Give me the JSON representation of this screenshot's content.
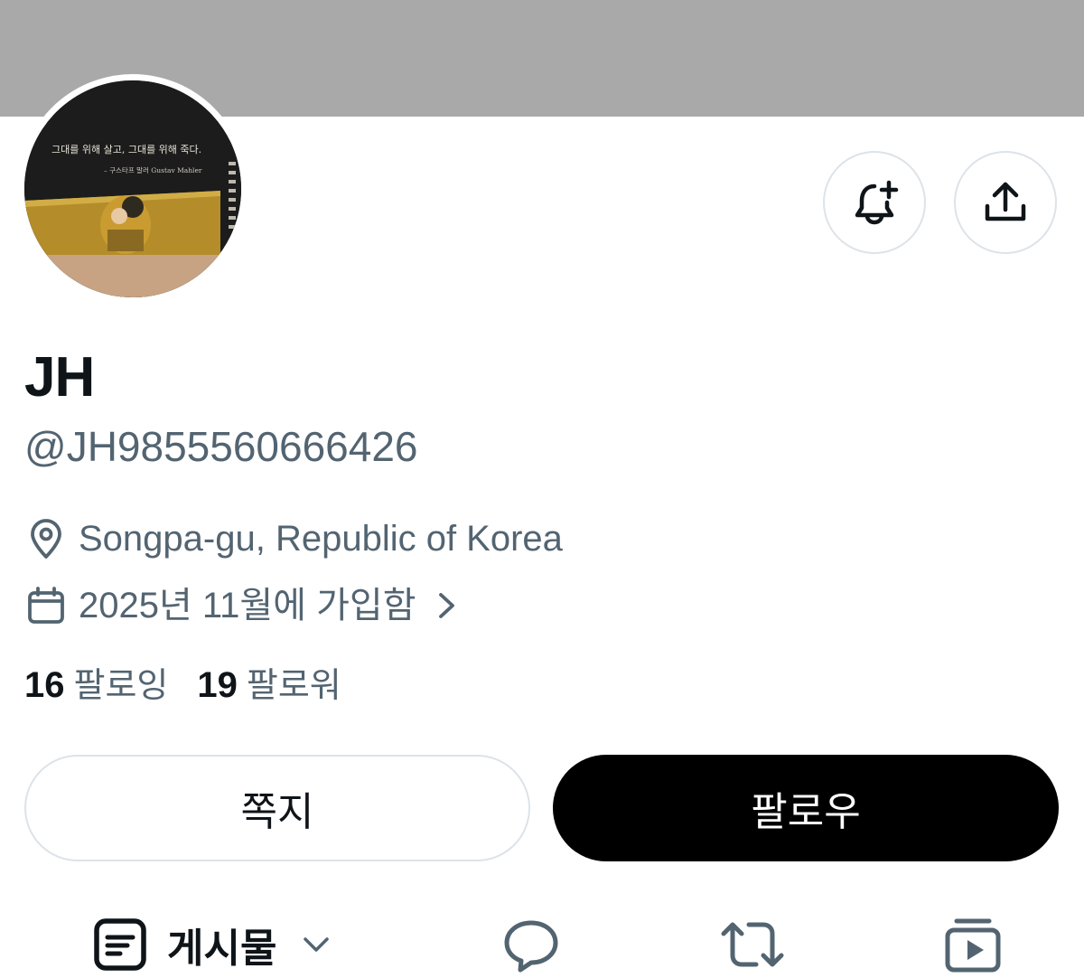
{
  "profile": {
    "display_name": "JH",
    "handle": "@JH9855560666426",
    "location": "Songpa-gu, Republic of Korea",
    "joined": "2025년 11월에 가입함",
    "following_count": "16",
    "following_label": "팔로잉",
    "followers_count": "19",
    "followers_label": "팔로워",
    "avatar_caption": "그대를 위해 살고, 그대를 위해 죽다.",
    "avatar_attribution": "– 구스타프 말러 Gustav Mahler"
  },
  "actions": {
    "message_label": "쪽지",
    "follow_label": "팔로우"
  },
  "tabs": {
    "posts_label": "게시물"
  },
  "icons": {
    "notify": "bell-plus-icon",
    "share": "share-upload-icon",
    "location": "map-pin-icon",
    "joined": "calendar-icon",
    "posts": "posts-icon",
    "replies": "reply-bubble-icon",
    "reposts": "repost-icon",
    "media": "media-play-icon"
  },
  "colors": {
    "banner": "#a9a9a9",
    "secondary_text": "#536471",
    "primary_text": "#0f1419",
    "border": "#dde3e8",
    "follow_button": "#000000"
  }
}
